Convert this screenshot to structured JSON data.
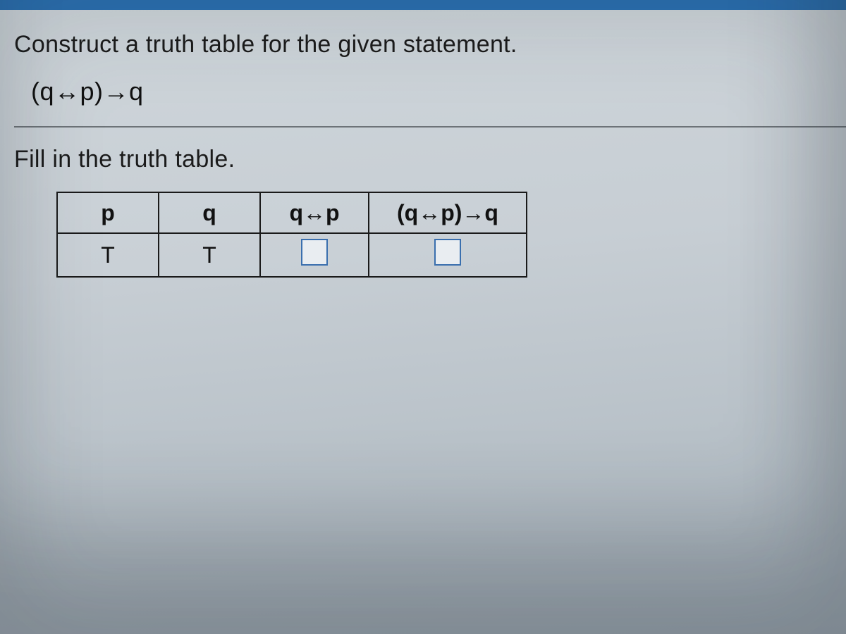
{
  "instruction": "Construct a truth table for the given statement.",
  "statement": "(q↔p)→q",
  "fill_instruction": "Fill in the truth table.",
  "table": {
    "headers": [
      "p",
      "q",
      "q↔p",
      "(q↔p)→q"
    ],
    "row": {
      "p": "T",
      "q": "T"
    }
  }
}
